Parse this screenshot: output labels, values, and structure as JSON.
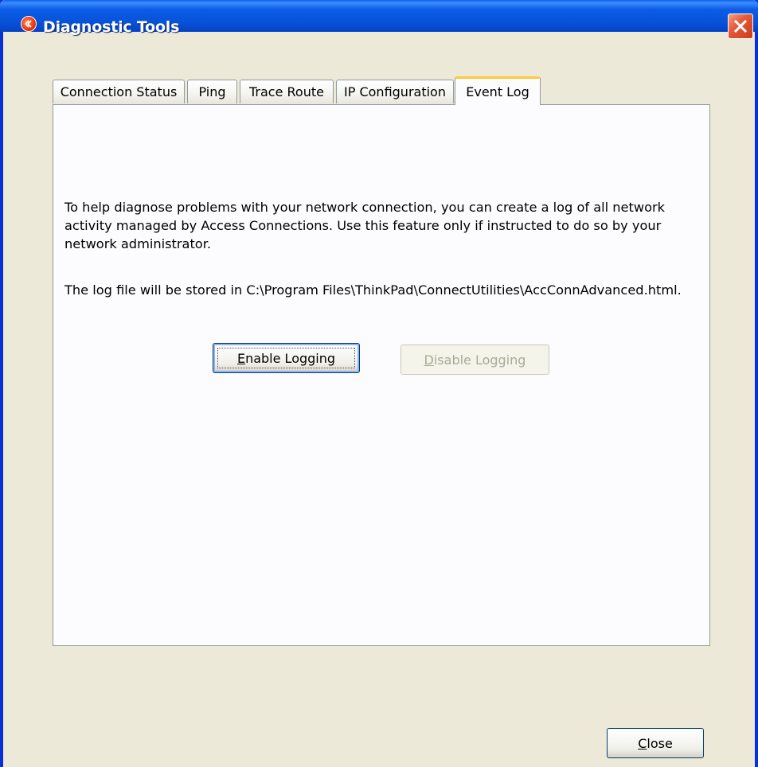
{
  "window": {
    "title": "Diagnostic Tools",
    "title_color": "#ffffff",
    "titlebar_color": "#0753d8",
    "close_icon": "close-icon"
  },
  "tabs": [
    {
      "label": "Connection Status",
      "active": false
    },
    {
      "label": "Ping",
      "active": false
    },
    {
      "label": "Trace Route",
      "active": false
    },
    {
      "label": "IP Configuration",
      "active": false
    },
    {
      "label": "Event Log",
      "active": true
    }
  ],
  "event_log": {
    "description": "To help diagnose problems with your network connection, you can create a log of all network activity managed by Access Connections. Use this feature only if instructed to do so by your network administrator.",
    "path_note": "The log file will be stored in C:\\Program Files\\ThinkPad\\ConnectUtilities\\AccConnAdvanced.html.",
    "enable_button": {
      "mnemonic": "E",
      "rest": "nable Logging",
      "enabled": true
    },
    "disable_button": {
      "mnemonic": "D",
      "rest": "isable Logging",
      "enabled": false
    }
  },
  "footer": {
    "close_button": {
      "mnemonic": "C",
      "rest": "lose"
    }
  },
  "colors": {
    "dialog_bg": "#ece9d8",
    "tab_highlight": "#ffc83c",
    "border": "#919b9c",
    "button_border": "#003c74"
  }
}
